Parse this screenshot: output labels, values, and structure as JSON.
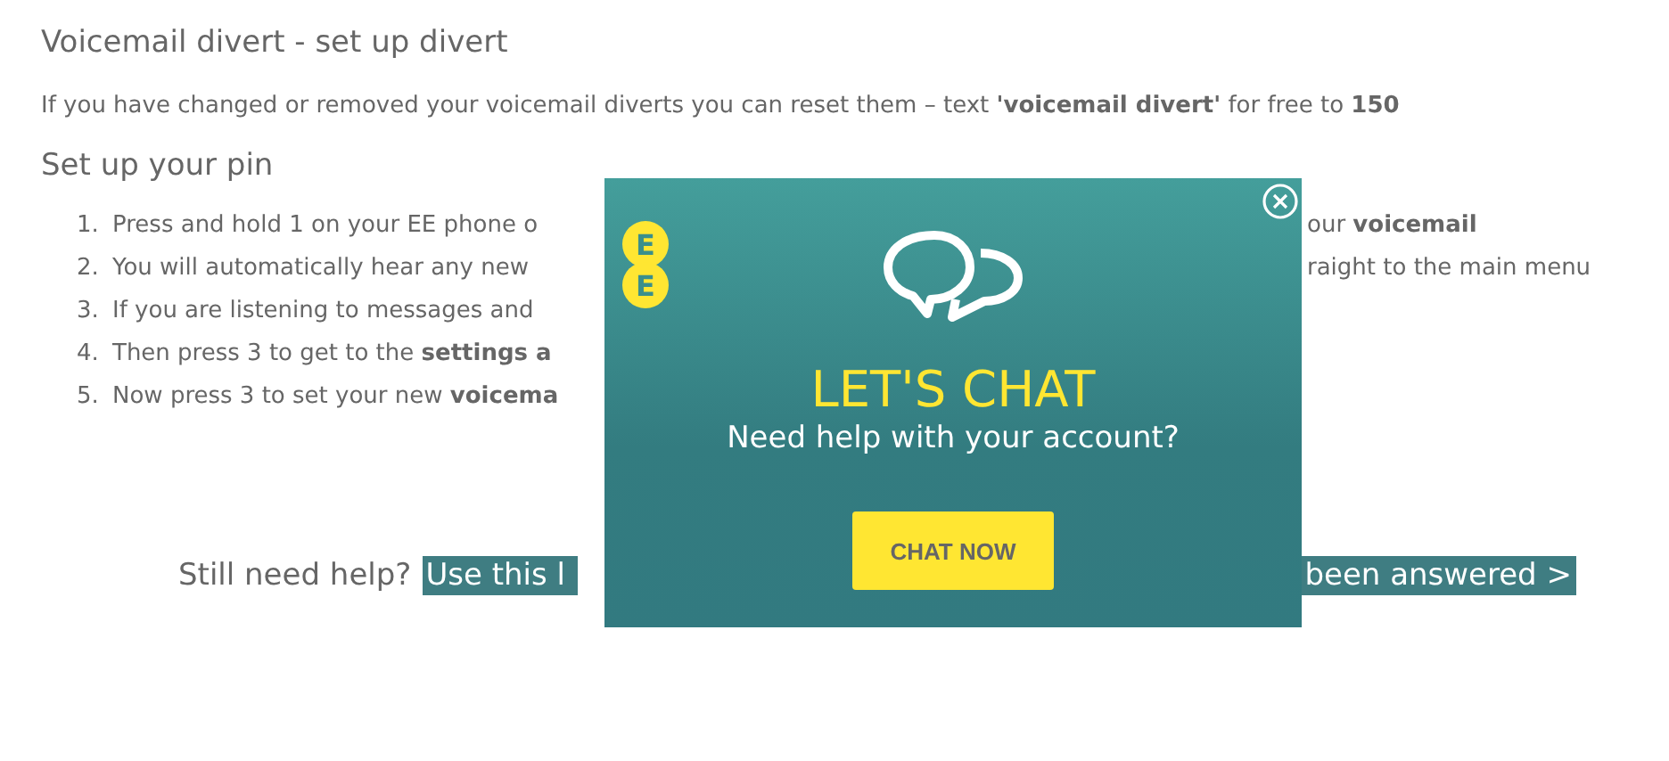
{
  "heading": "Voicemail divert - set up divert",
  "intro": "If you have changed or removed your voicemail diverts you can reset them – text **'voicemail divert'** for free to **150**",
  "subheading": "Set up your pin",
  "steps": [
    {
      "number": "1.",
      "text_left": "Press and hold 1 on your EE phone o",
      "text_right": "our **voicemail**"
    },
    {
      "number": "2.",
      "text_left": "You will automatically hear any new",
      "text_right": "raight to the main menu"
    },
    {
      "number": "3.",
      "text_left": "If you are listening to messages and"
    },
    {
      "number": "4.",
      "text_left": "Then press 3 to get to the **settings a**"
    },
    {
      "number": "5.",
      "text_left": "Now press 3 to set your new **voicema**"
    }
  ],
  "help": {
    "label": "Still need help?",
    "link_left": "Use this l",
    "link_right": "been answered >"
  },
  "popup": {
    "logo": [
      "E",
      "E"
    ],
    "title": "LET'S CHAT",
    "subtitle": "Need help with your account?",
    "button": "CHAT NOW"
  }
}
